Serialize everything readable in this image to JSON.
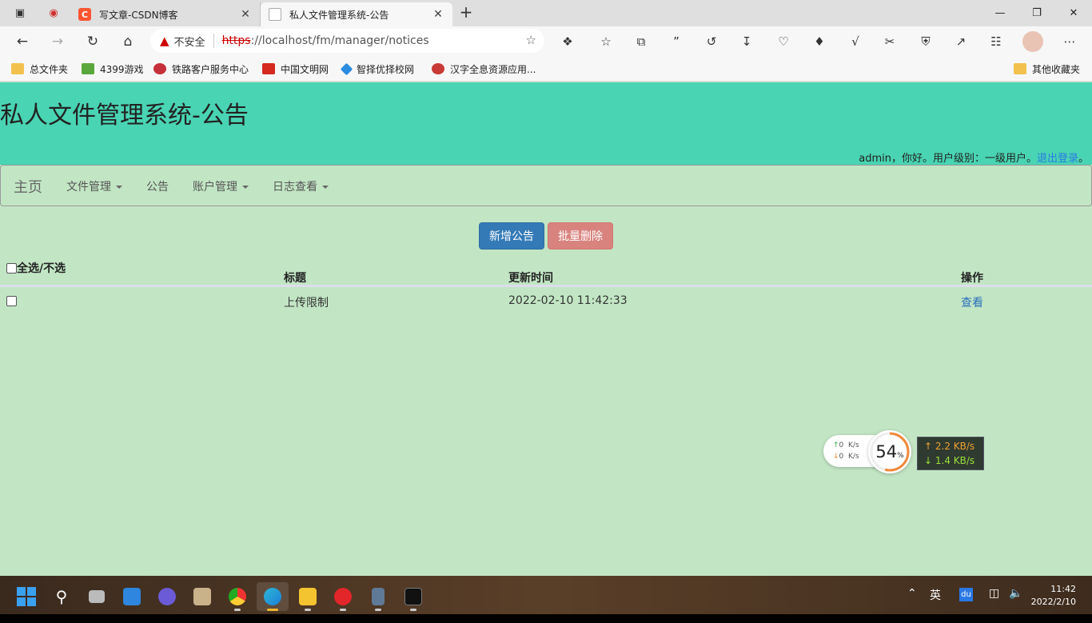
{
  "browser": {
    "tabs": [
      {
        "title": "写文章-CSDN博客",
        "favicon_color": "#fc5531",
        "favicon_letter": "C"
      },
      {
        "title": "私人文件管理系统-公告",
        "favicon_color": "#ffffff",
        "favicon_letter": ""
      }
    ],
    "address": {
      "warning_label": "不安全",
      "protocol": "https",
      "rest": "://localhost/fm/manager/notices"
    },
    "bookmarks": [
      {
        "label": "总文件夹",
        "color": "#f2c14e"
      },
      {
        "label": "4399游戏",
        "color": "#5aa83c"
      },
      {
        "label": "铁路客户服务中心",
        "color": "#c6303b"
      },
      {
        "label": "中国文明网",
        "color": "#d42a20"
      },
      {
        "label": "智择优择校网",
        "color": "#2a8de0"
      },
      {
        "label": "汉字全息资源应用...",
        "color": "#c83a35"
      },
      {
        "label": "其他收藏夹",
        "color": "#f2c14e"
      }
    ]
  },
  "page": {
    "title": "私人文件管理系统-公告",
    "user_text": "admin，你好。用户级别：一级用户。",
    "logout_link": "退出登录",
    "logout_suffix": "。",
    "nav": {
      "brand": "主页",
      "items": [
        {
          "label": "文件管理",
          "dropdown": true
        },
        {
          "label": "公告",
          "dropdown": false
        },
        {
          "label": "账户管理",
          "dropdown": true
        },
        {
          "label": "日志查看",
          "dropdown": true
        }
      ]
    },
    "buttons": {
      "add": "新增公告",
      "batch_delete": "批量删除"
    },
    "table": {
      "headers": {
        "select_all": "全选/不选",
        "title": "标题",
        "updated": "更新时间",
        "action": "操作"
      },
      "rows": [
        {
          "title": "上传限制",
          "updated": "2022-02-10 11:42:33",
          "action": "查看"
        }
      ]
    }
  },
  "widget": {
    "net_up": "0",
    "net_down": "0",
    "net_unit": "K/s",
    "cpu_value": "54",
    "cpu_unit": "%",
    "cpu_fraction": 0.54,
    "speed_up": "↑ 2.2 KB/s",
    "speed_down": "↓ 1.4 KB/s"
  },
  "taskbar": {
    "ime": "英",
    "time": "11:42",
    "date": "2022/2/10"
  }
}
